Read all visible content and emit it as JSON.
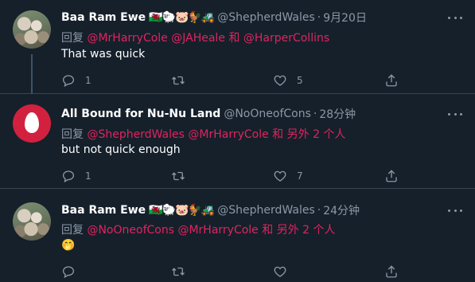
{
  "colors": {
    "background": "#15202b",
    "muted": "#8b98a5",
    "mention": "#e0245e",
    "divider": "#38444d"
  },
  "tweets": [
    {
      "name": "Baa Ram Ewe",
      "emojis": "🏴󠁧󠁢󠁷󠁬󠁳󠁿🐑🐷🐓🚜",
      "handle": "@ShepherdWales",
      "dot": "·",
      "time": "9月20日",
      "reply_prefix": "回复",
      "mentions": [
        "@MrHarryCole",
        "@JAHeale",
        "和",
        "@HarperCollins"
      ],
      "text": "That was quick",
      "reply_count": "1",
      "retweet_count": "",
      "like_count": "5"
    },
    {
      "name": "All Bound for Nu-Nu Land",
      "emojis": "",
      "handle": "@NoOneofCons",
      "dot": "·",
      "time": "28分钟",
      "reply_prefix": "回复",
      "mentions": [
        "@ShepherdWales",
        "@MrHarryCole",
        "和",
        "另外 2 个人"
      ],
      "text": "but not quick enough",
      "reply_count": "1",
      "retweet_count": "",
      "like_count": "7"
    },
    {
      "name": "Baa Ram Ewe",
      "emojis": "🏴󠁧󠁢󠁷󠁬󠁳󠁿🐑🐷🐓🚜",
      "handle": "@ShepherdWales",
      "dot": "·",
      "time": "24分钟",
      "reply_prefix": "回复",
      "mentions": [
        "@NoOneofCons",
        "@MrHarryCole",
        "和",
        "另外 2 个人"
      ],
      "text": "🤭",
      "reply_count": "",
      "retweet_count": "",
      "like_count": ""
    }
  ]
}
